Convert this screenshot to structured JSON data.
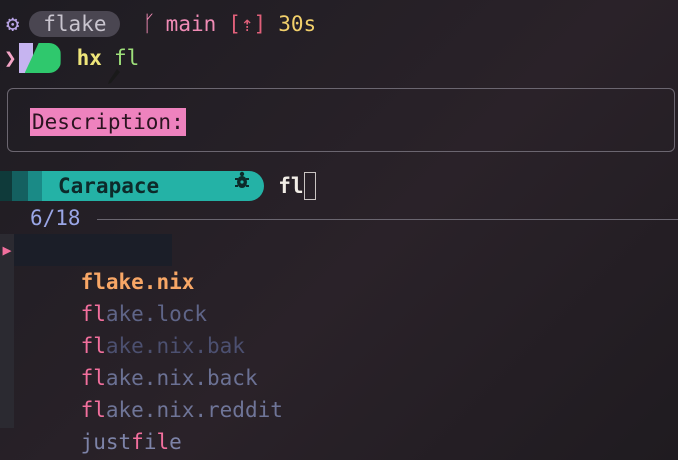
{
  "prompt": {
    "gear_icon": "⚙",
    "directory": "flake",
    "branch_icon": "ᚴ",
    "branch": "main",
    "ahead_indicator": "[⇡]",
    "duration": "30s"
  },
  "command": {
    "chevron": "❯",
    "program": "hx",
    "argument": "fl",
    "badge_icon": "pencil-icon"
  },
  "description": {
    "label": "Description:"
  },
  "carapace": {
    "label": "Carapace",
    "icon": "turtle-icon",
    "typed": "fl"
  },
  "results": {
    "count": "6/18",
    "items": [
      {
        "match": "fl",
        "rest": "ake.nix",
        "selected": true
      },
      {
        "match": "fl",
        "rest": "ake.lock",
        "selected": false
      },
      {
        "match": "fl",
        "rest": "ake.nix.bak",
        "selected": false
      },
      {
        "match": "fl",
        "rest": "ake.nix.back",
        "selected": false
      },
      {
        "match": "fl",
        "rest": "ake.nix.reddit",
        "selected": false
      },
      {
        "pre": "just",
        "match": "f",
        "mid": "i",
        "match2": "l",
        "rest": "e",
        "selected": false
      }
    ]
  },
  "colors": {
    "accent_green": "#2fc86d",
    "carapace_teal": "#24b2a6",
    "description_pink": "#ee82be",
    "match_pink": "#f26f9d",
    "selected_orange": "#f8a766"
  }
}
